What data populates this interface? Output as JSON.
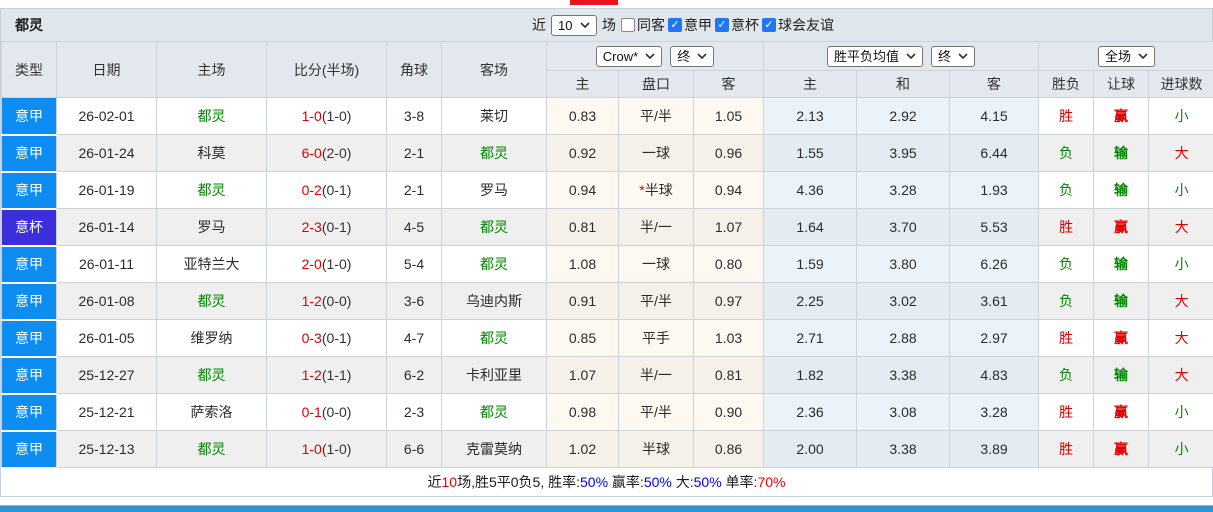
{
  "title_bar": {
    "team": "都灵",
    "near_label": "近",
    "matches_select": "10",
    "games_label": "场",
    "checkboxes": [
      {
        "label": "同客",
        "checked": false
      },
      {
        "label": "意甲",
        "checked": true
      },
      {
        "label": "意杯",
        "checked": true
      },
      {
        "label": "球会友谊",
        "checked": true
      }
    ]
  },
  "header": {
    "simple_cols": [
      "类型",
      "日期",
      "主场",
      "比分(半场)",
      "角球",
      "客场"
    ],
    "odds_group": {
      "select1": "Crow*",
      "select2": "终",
      "sub": [
        "主",
        "盘口",
        "客"
      ]
    },
    "avg_group": {
      "select1": "胜平负均值",
      "select2": "终",
      "sub": [
        "主",
        "和",
        "客"
      ]
    },
    "result_group": {
      "select1": "全场",
      "sub": [
        "胜负",
        "让球",
        "进球数"
      ]
    }
  },
  "rows": [
    {
      "league": "意甲",
      "league_class": "lg-blue",
      "date": "26-02-01",
      "home": "都灵",
      "home_class": "green",
      "score_ft": "1-0",
      "score_ht": "(1-0)",
      "corner": "3-8",
      "away": "莱切",
      "away_class": "dark",
      "odds_home": "0.83",
      "handicap_prefix": "",
      "handicap": "平/半",
      "odds_away": "1.05",
      "avg_home": "2.13",
      "avg_draw": "2.92",
      "avg_away": "4.15",
      "result": "胜",
      "result_class": "red",
      "handicap_result": "赢",
      "handicap_result_class": "red",
      "goals": "小",
      "goals_class": "green"
    },
    {
      "league": "意甲",
      "league_class": "lg-blue",
      "date": "26-01-24",
      "home": "科莫",
      "home_class": "dark",
      "score_ft": "6-0",
      "score_ht": "(2-0)",
      "corner": "2-1",
      "away": "都灵",
      "away_class": "green",
      "odds_home": "0.92",
      "handicap_prefix": "",
      "handicap": "一球",
      "odds_away": "0.96",
      "avg_home": "1.55",
      "avg_draw": "3.95",
      "avg_away": "6.44",
      "result": "负",
      "result_class": "green",
      "handicap_result": "输",
      "handicap_result_class": "green",
      "goals": "大",
      "goals_class": "red"
    },
    {
      "league": "意甲",
      "league_class": "lg-blue",
      "date": "26-01-19",
      "home": "都灵",
      "home_class": "green",
      "score_ft": "0-2",
      "score_ht": "(0-1)",
      "corner": "2-1",
      "away": "罗马",
      "away_class": "dark",
      "odds_home": "0.94",
      "handicap_prefix": "*",
      "handicap": "半球",
      "odds_away": "0.94",
      "avg_home": "4.36",
      "avg_draw": "3.28",
      "avg_away": "1.93",
      "result": "负",
      "result_class": "green",
      "handicap_result": "输",
      "handicap_result_class": "green",
      "goals": "小",
      "goals_class": "green"
    },
    {
      "league": "意杯",
      "league_class": "lg-purple",
      "date": "26-01-14",
      "home": "罗马",
      "home_class": "dark",
      "score_ft": "2-3",
      "score_ht": "(0-1)",
      "corner": "4-5",
      "away": "都灵",
      "away_class": "green",
      "odds_home": "0.81",
      "handicap_prefix": "",
      "handicap": "半/一",
      "odds_away": "1.07",
      "avg_home": "1.64",
      "avg_draw": "3.70",
      "avg_away": "5.53",
      "result": "胜",
      "result_class": "red",
      "handicap_result": "赢",
      "handicap_result_class": "red",
      "goals": "大",
      "goals_class": "red"
    },
    {
      "league": "意甲",
      "league_class": "lg-blue",
      "date": "26-01-11",
      "home": "亚特兰大",
      "home_class": "dark",
      "score_ft": "2-0",
      "score_ht": "(1-0)",
      "corner": "5-4",
      "away": "都灵",
      "away_class": "green",
      "odds_home": "1.08",
      "handicap_prefix": "",
      "handicap": "一球",
      "odds_away": "0.80",
      "avg_home": "1.59",
      "avg_draw": "3.80",
      "avg_away": "6.26",
      "result": "负",
      "result_class": "green",
      "handicap_result": "输",
      "handicap_result_class": "green",
      "goals": "小",
      "goals_class": "green"
    },
    {
      "league": "意甲",
      "league_class": "lg-blue",
      "date": "26-01-08",
      "home": "都灵",
      "home_class": "green",
      "score_ft": "1-2",
      "score_ht": "(0-0)",
      "corner": "3-6",
      "away": "乌迪内斯",
      "away_class": "dark",
      "odds_home": "0.91",
      "handicap_prefix": "",
      "handicap": "平/半",
      "odds_away": "0.97",
      "avg_home": "2.25",
      "avg_draw": "3.02",
      "avg_away": "3.61",
      "result": "负",
      "result_class": "green",
      "handicap_result": "输",
      "handicap_result_class": "green",
      "goals": "大",
      "goals_class": "red"
    },
    {
      "league": "意甲",
      "league_class": "lg-blue",
      "date": "26-01-05",
      "home": "维罗纳",
      "home_class": "dark",
      "score_ft": "0-3",
      "score_ht": "(0-1)",
      "corner": "4-7",
      "away": "都灵",
      "away_class": "green",
      "odds_home": "0.85",
      "handicap_prefix": "",
      "handicap": "平手",
      "odds_away": "1.03",
      "avg_home": "2.71",
      "avg_draw": "2.88",
      "avg_away": "2.97",
      "result": "胜",
      "result_class": "red",
      "handicap_result": "赢",
      "handicap_result_class": "red",
      "goals": "大",
      "goals_class": "red"
    },
    {
      "league": "意甲",
      "league_class": "lg-blue",
      "date": "25-12-27",
      "home": "都灵",
      "home_class": "green",
      "score_ft": "1-2",
      "score_ht": "(1-1)",
      "corner": "6-2",
      "away": "卡利亚里",
      "away_class": "dark",
      "odds_home": "1.07",
      "handicap_prefix": "",
      "handicap": "半/一",
      "odds_away": "0.81",
      "avg_home": "1.82",
      "avg_draw": "3.38",
      "avg_away": "4.83",
      "result": "负",
      "result_class": "green",
      "handicap_result": "输",
      "handicap_result_class": "green",
      "goals": "大",
      "goals_class": "red"
    },
    {
      "league": "意甲",
      "league_class": "lg-blue",
      "date": "25-12-21",
      "home": "萨索洛",
      "home_class": "dark",
      "score_ft": "0-1",
      "score_ht": "(0-0)",
      "corner": "2-3",
      "away": "都灵",
      "away_class": "green",
      "odds_home": "0.98",
      "handicap_prefix": "",
      "handicap": "平/半",
      "odds_away": "0.90",
      "avg_home": "2.36",
      "avg_draw": "3.08",
      "avg_away": "3.28",
      "result": "胜",
      "result_class": "red",
      "handicap_result": "赢",
      "handicap_result_class": "red",
      "goals": "小",
      "goals_class": "green"
    },
    {
      "league": "意甲",
      "league_class": "lg-blue",
      "date": "25-12-13",
      "home": "都灵",
      "home_class": "green",
      "score_ft": "1-0",
      "score_ht": "(1-0)",
      "corner": "6-6",
      "away": "克雷莫纳",
      "away_class": "dark",
      "odds_home": "1.02",
      "handicap_prefix": "",
      "handicap": "半球",
      "odds_away": "0.86",
      "avg_home": "2.00",
      "avg_draw": "3.38",
      "avg_away": "3.89",
      "result": "胜",
      "result_class": "red",
      "handicap_result": "赢",
      "handicap_result_class": "red",
      "goals": "小",
      "goals_class": "green"
    }
  ],
  "summary_segments": [
    {
      "text": "近",
      "class": "s-black"
    },
    {
      "text": "10",
      "class": "s-red"
    },
    {
      "text": "场,胜5平0负5, 胜率:",
      "class": "s-black"
    },
    {
      "text": "50%",
      "class": "s-blue"
    },
    {
      "text": " 赢率:",
      "class": "s-black"
    },
    {
      "text": "50%",
      "class": "s-blue"
    },
    {
      "text": " 大:",
      "class": "s-black"
    },
    {
      "text": "50%",
      "class": "s-blue"
    },
    {
      "text": " 单率:",
      "class": "s-black"
    },
    {
      "text": "70%",
      "class": "s-red"
    }
  ],
  "colors": {
    "league_badge_blue": "#0d8cf2",
    "cup_badge_purple": "#3a2edd",
    "win_red": "#e00000",
    "loss_green": "#008800",
    "rate_blue": "#0000ee",
    "rate_red": "#ee0000",
    "bottom_bar_blue": "#3190cd",
    "header_bg": "#e2e8ee",
    "title_bar_bg": "#dfe6ec"
  }
}
